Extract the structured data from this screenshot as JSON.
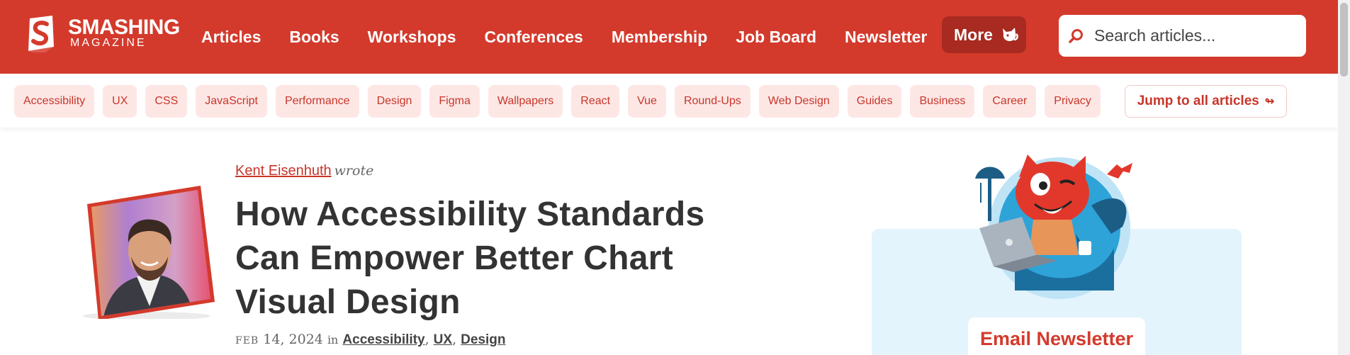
{
  "brand": {
    "title": "SMASHING",
    "subtitle": "MAGAZINE",
    "primary_color": "#d33a2c",
    "tag_bg": "#fde7e5"
  },
  "nav": {
    "items": [
      "Articles",
      "Books",
      "Workshops",
      "Conferences",
      "Membership",
      "Job Board",
      "Newsletter"
    ],
    "more_label": "More",
    "more_icon": "cat-icon"
  },
  "search": {
    "placeholder": "Search articles...",
    "icon": "search-icon"
  },
  "tags": [
    "Accessibility",
    "UX",
    "CSS",
    "JavaScript",
    "Performance",
    "Design",
    "Figma",
    "Wallpapers",
    "React",
    "Vue",
    "Round-Ups",
    "Web Design",
    "Guides",
    "Business",
    "Career",
    "Privacy"
  ],
  "jump": {
    "label": "Jump to all articles",
    "icon": "arrow-right-icon"
  },
  "article": {
    "author": "Kent Eisenhuth",
    "wrote": "wrote",
    "title": "How Accessibility Standards Can Empower Better Chart Visual Design",
    "date_month": "FEB",
    "date_rest": "14, 2024",
    "in": "in",
    "categories": [
      "Accessibility",
      "UX",
      "Design"
    ]
  },
  "sidebar": {
    "newsletter_label": "Email Newsletter"
  }
}
